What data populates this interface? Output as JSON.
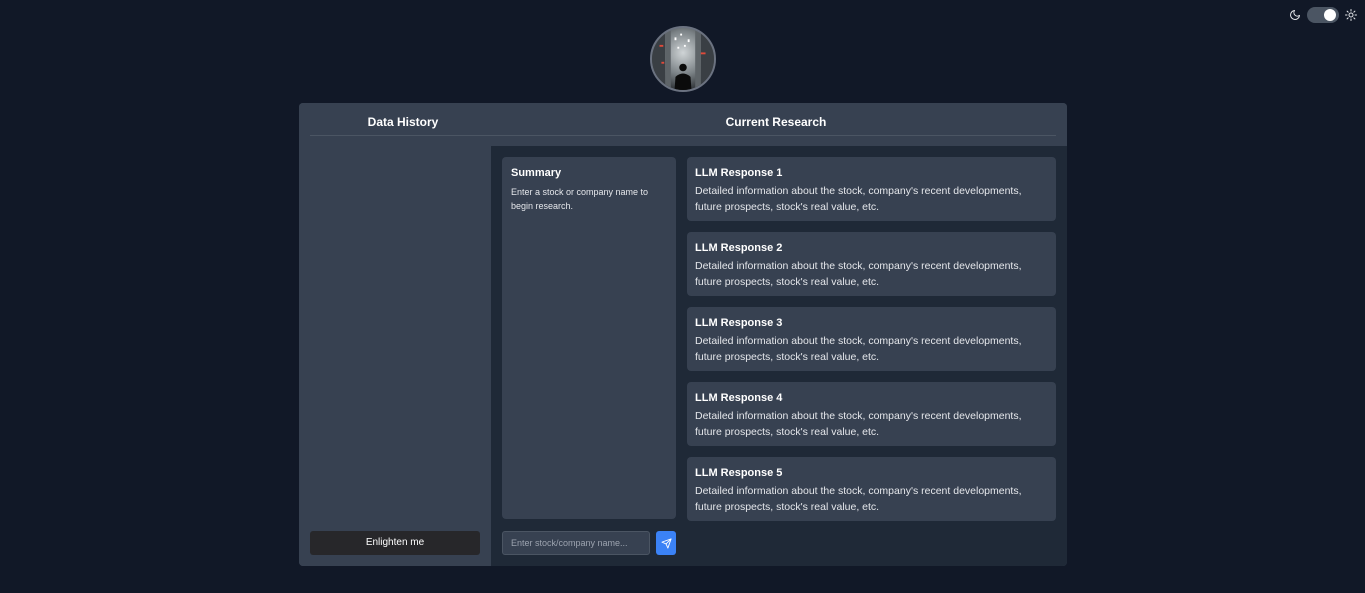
{
  "colors": {
    "page_bg": "#111827",
    "panel_bg": "#374151",
    "main_bg": "#1f2937",
    "accent": "#3b82f6"
  },
  "theme_toggle": {
    "left_icon": "moon-icon",
    "right_icon": "sun-icon",
    "state": "on"
  },
  "avatar": {
    "icon": "avatar-image"
  },
  "header": {
    "left_title": "Data History",
    "right_title": "Current Research"
  },
  "sidebar": {
    "button_label": "Enlighten me"
  },
  "summary": {
    "title": "Summary",
    "text": "Enter a stock or company name to begin research."
  },
  "responses": [
    {
      "title": "LLM Response 1",
      "text": "Detailed information about the stock, company's recent developments, future prospects, stock's real value, etc."
    },
    {
      "title": "LLM Response 2",
      "text": "Detailed information about the stock, company's recent developments, future prospects, stock's real value, etc."
    },
    {
      "title": "LLM Response 3",
      "text": "Detailed information about the stock, company's recent developments, future prospects, stock's real value, etc."
    },
    {
      "title": "LLM Response 4",
      "text": "Detailed information about the stock, company's recent developments, future prospects, stock's real value, etc."
    },
    {
      "title": "LLM Response 5",
      "text": "Detailed information about the stock, company's recent developments, future prospects, stock's real value, etc."
    }
  ],
  "search": {
    "placeholder": "Enter stock/company name...",
    "value": "",
    "send_icon": "send-icon"
  }
}
